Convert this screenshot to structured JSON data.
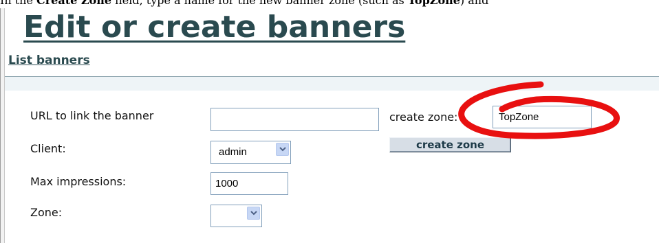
{
  "caption": {
    "prefix": "In the ",
    "field_name": "Create Zone",
    "middle": " field, type a name for the new banner zone (such as ",
    "example": "TopZone",
    "suffix": ") and"
  },
  "page": {
    "title": "Edit or create banners",
    "list_banners_link": "List banners"
  },
  "form": {
    "url_label": "URL to link the banner",
    "url_value": "",
    "client_label": "Client:",
    "client_selected": "admin",
    "max_impressions_label": "Max impressions:",
    "max_impressions_value": "1000",
    "zone_label": "Zone:",
    "zone_selected": ""
  },
  "create_zone": {
    "label": "create zone:",
    "value": "TopZone",
    "button_label": "create zone"
  },
  "colors": {
    "title": "#2a4a4f",
    "annotation_circle": "#e81010",
    "input_border": "#7f9db9",
    "select_arrow": "#c7d7f5"
  },
  "icons": {
    "dropdown": "chevron-down-icon",
    "annotation": "red-circle-highlight"
  }
}
